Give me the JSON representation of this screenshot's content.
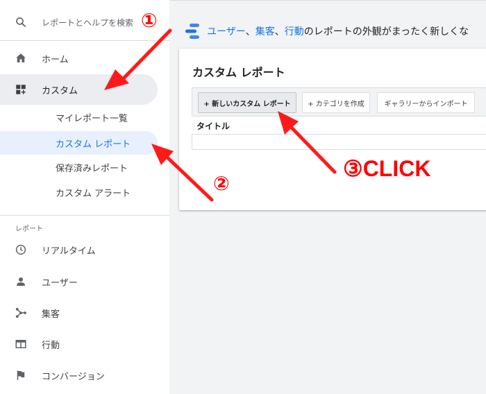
{
  "sidebar": {
    "search_placeholder": "レポートとヘルプを検索",
    "home_label": "ホーム",
    "custom_label": "カスタム",
    "custom_sub": [
      "マイレポート一覧",
      "カスタム レポート",
      "保存済みレポート",
      "カスタム アラート"
    ],
    "reports_section": "レポート",
    "report_items": [
      {
        "label": "リアルタイム",
        "icon": "clock-icon"
      },
      {
        "label": "ユーザー",
        "icon": "person-icon"
      },
      {
        "label": "集客",
        "icon": "acquisition-icon"
      },
      {
        "label": "行動",
        "icon": "behavior-icon"
      },
      {
        "label": "コンバージョン",
        "icon": "flag-icon"
      }
    ]
  },
  "banner": {
    "link_users": "ユーザー",
    "sep1": "、",
    "link_acquisition": "集客",
    "sep2": "、",
    "link_behavior": "行動",
    "rest": "のレポートの外観がまったく新しくな"
  },
  "panel": {
    "title": "カスタム レポート",
    "buttons": {
      "new_report": "+ 新しいカスタム レポート",
      "create_category": "+ カテゴリを作成",
      "import_gallery": "ギャラリーからインポート"
    },
    "table_header": "タイトル"
  },
  "annotations": {
    "step1": "①",
    "step2": "②",
    "step3": "③CLICK",
    "color": "#ff1a1a"
  },
  "colors": {
    "accent": "#1a73e8",
    "selected_bg": "#e8f0fe",
    "page_bg": "#f1f3f4"
  }
}
